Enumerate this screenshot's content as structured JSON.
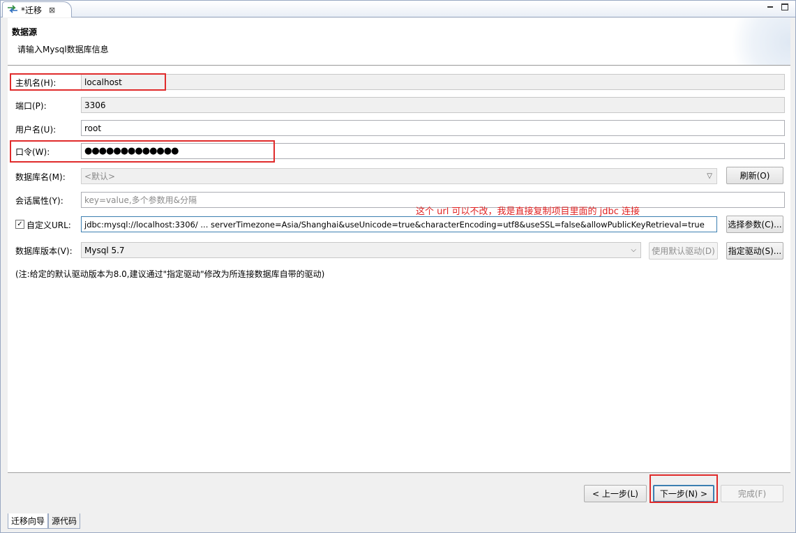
{
  "tab": {
    "title": "*迁移",
    "close": "⊠"
  },
  "header": {
    "title": "数据源",
    "subtitle": "请输入Mysql数据库信息"
  },
  "form": {
    "host": {
      "label": "主机名(H):",
      "value": "localhost"
    },
    "port": {
      "label": "端口(P):",
      "value": "3306"
    },
    "user": {
      "label": "用户名(U):",
      "value": "root"
    },
    "password": {
      "label": "口令(W):",
      "value": "●●●●●●●●●●●●●"
    },
    "database": {
      "label": "数据库名(M):",
      "value": "<默认>"
    },
    "refresh_label": "刷新(O)",
    "session": {
      "label": "会话属性(Y):",
      "placeholder": "key=value,多个参数用&分隔"
    },
    "custom_url": {
      "label": "自定义URL:",
      "checked": true,
      "value": "jdbc:mysql://localhost:3306/ ... serverTimezone=Asia/Shanghai&useUnicode=true&characterEncoding=utf8&useSSL=false&allowPublicKeyRetrieval=true"
    },
    "choose_params_label": "选择参数(C)...",
    "db_version": {
      "label": "数据库版本(V):",
      "value": "Mysql 5.7"
    },
    "default_driver_label": "使用默认驱动(D)",
    "specify_driver_label": "指定驱动(S)...",
    "note": "(注:给定的默认驱动版本为8.0,建议通过\"指定驱动\"修改为所连接数据库自带的驱动)"
  },
  "annotation": "这个 url 可以不改，我是直接复制项目里面的 jdbc 连接",
  "buttons": {
    "prev": "< 上一步(L)",
    "next": "下一步(N) >",
    "finish": "完成(F)"
  },
  "bottom_tabs": [
    "迁移向导",
    "源代码"
  ],
  "colors": {
    "highlight": "#e02b2b",
    "default_button": "#3c7fb1"
  }
}
